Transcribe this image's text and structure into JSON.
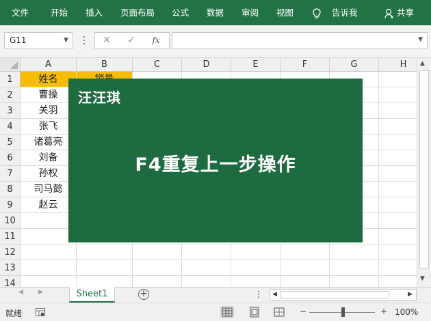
{
  "ribbon": {
    "tabs": [
      "文件",
      "开始",
      "插入",
      "页面布局",
      "公式",
      "数据",
      "审阅",
      "视图"
    ],
    "tell_me": "告诉我",
    "share": "共享"
  },
  "formula_bar": {
    "name_box": "G11",
    "cancel_icon": "✕",
    "enter_icon": "✓",
    "fx_label": "fx",
    "formula": ""
  },
  "sheet": {
    "columns": [
      "A",
      "B",
      "C",
      "D",
      "E",
      "F",
      "G",
      "H"
    ],
    "rows": [
      "1",
      "2",
      "3",
      "4",
      "5",
      "6",
      "7",
      "8",
      "9",
      "10",
      "11",
      "12",
      "13",
      "14"
    ],
    "cells": {
      "A1": "姓名",
      "B1": "销量",
      "A2": "曹操",
      "A3": "关羽",
      "A4": "张飞",
      "A5": "诸葛亮",
      "A6": "刘备",
      "A7": "孙权",
      "A8": "司马懿",
      "A9": "赵云"
    },
    "header_fill": "#f5bd05"
  },
  "overlay": {
    "author": "汪汪琪",
    "title": "F4重复上一步操作",
    "background": "#1e6b42"
  },
  "tabs": {
    "sheet_name": "Sheet1",
    "add_icon": "+"
  },
  "status_bar": {
    "ready": "就绪",
    "zoom_out": "−",
    "zoom_in": "+",
    "zoom": "100%",
    "zoom_level_percent": 100
  },
  "colors": {
    "accent": "#217346"
  }
}
